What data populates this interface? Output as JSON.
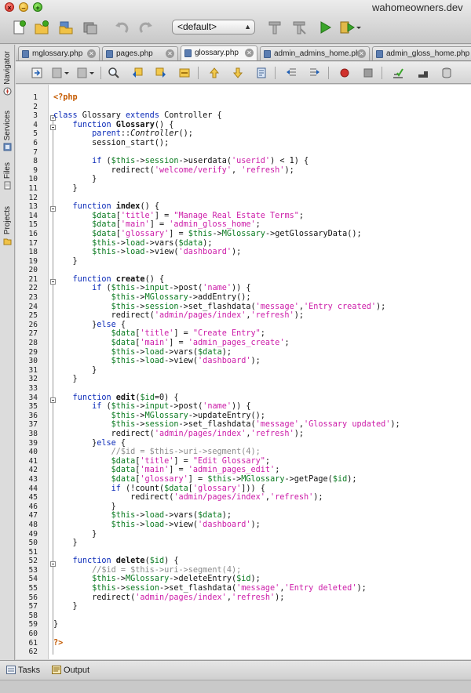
{
  "window": {
    "title": "wahomeowners.dev"
  },
  "toolbar": {
    "config_selected": "<default>"
  },
  "side_tabs": [
    "Navigator",
    "Services",
    "Files",
    "Projects"
  ],
  "tabs": [
    "mglossary.php",
    "pages.php",
    "glossary.php",
    "admin_admins_home.php",
    "admin_gloss_home.php"
  ],
  "active_tab": "glossary.php",
  "bottom": {
    "tasks": "Tasks",
    "output": "Output"
  },
  "code": [
    {
      "n": "1",
      "s": [
        [
          "tag",
          "<?php"
        ]
      ]
    },
    {
      "n": "2",
      "s": []
    },
    {
      "n": "3",
      "s": [
        [
          "kw",
          "class"
        ],
        [
          "p",
          " Glossary "
        ],
        [
          "kw",
          "extends"
        ],
        [
          "p",
          " Controller {"
        ]
      ]
    },
    {
      "n": "4",
      "s": [
        [
          "p",
          "    "
        ],
        [
          "kw",
          "function"
        ],
        [
          "p",
          " "
        ],
        [
          "fn",
          "Glossary"
        ],
        [
          "p",
          "() {"
        ]
      ]
    },
    {
      "n": "5",
      "s": [
        [
          "p",
          "        "
        ],
        [
          "kw",
          "parent"
        ],
        [
          "p",
          "::"
        ],
        [
          "it",
          "Controller"
        ],
        [
          "p",
          "();"
        ]
      ]
    },
    {
      "n": "6",
      "s": [
        [
          "p",
          "        session_start();"
        ]
      ]
    },
    {
      "n": "7",
      "s": []
    },
    {
      "n": "8",
      "s": [
        [
          "p",
          "        "
        ],
        [
          "kw",
          "if"
        ],
        [
          "p",
          " ("
        ],
        [
          "var",
          "$this"
        ],
        [
          "p",
          "->"
        ],
        [
          "var",
          "session"
        ],
        [
          "p",
          "->userdata("
        ],
        [
          "str",
          "'userid'"
        ],
        [
          "p",
          ") < 1) {"
        ]
      ]
    },
    {
      "n": "9",
      "s": [
        [
          "p",
          "            redirect("
        ],
        [
          "str",
          "'welcome/verify'"
        ],
        [
          "p",
          ", "
        ],
        [
          "str",
          "'refresh'"
        ],
        [
          "p",
          ");"
        ]
      ]
    },
    {
      "n": "10",
      "s": [
        [
          "p",
          "        }"
        ]
      ]
    },
    {
      "n": "11",
      "s": [
        [
          "p",
          "    }"
        ]
      ]
    },
    {
      "n": "12",
      "s": []
    },
    {
      "n": "13",
      "s": [
        [
          "p",
          "    "
        ],
        [
          "kw",
          "function"
        ],
        [
          "p",
          " "
        ],
        [
          "fn",
          "index"
        ],
        [
          "p",
          "() {"
        ]
      ]
    },
    {
      "n": "14",
      "s": [
        [
          "p",
          "        "
        ],
        [
          "var",
          "$data"
        ],
        [
          "p",
          "["
        ],
        [
          "str",
          "'title'"
        ],
        [
          "p",
          "] = "
        ],
        [
          "str",
          "\"Manage Real Estate Terms\""
        ],
        [
          "p",
          ";"
        ]
      ]
    },
    {
      "n": "15",
      "s": [
        [
          "p",
          "        "
        ],
        [
          "var",
          "$data"
        ],
        [
          "p",
          "["
        ],
        [
          "str",
          "'main'"
        ],
        [
          "p",
          "] = "
        ],
        [
          "str",
          "'admin_gloss_home'"
        ],
        [
          "p",
          ";"
        ]
      ]
    },
    {
      "n": "16",
      "s": [
        [
          "p",
          "        "
        ],
        [
          "var",
          "$data"
        ],
        [
          "p",
          "["
        ],
        [
          "str",
          "'glossary'"
        ],
        [
          "p",
          "] = "
        ],
        [
          "var",
          "$this"
        ],
        [
          "p",
          "->"
        ],
        [
          "var",
          "MGlossary"
        ],
        [
          "p",
          "->getGlossaryData();"
        ]
      ]
    },
    {
      "n": "17",
      "s": [
        [
          "p",
          "        "
        ],
        [
          "var",
          "$this"
        ],
        [
          "p",
          "->"
        ],
        [
          "var",
          "load"
        ],
        [
          "p",
          "->vars("
        ],
        [
          "var",
          "$data"
        ],
        [
          "p",
          ");"
        ]
      ]
    },
    {
      "n": "18",
      "s": [
        [
          "p",
          "        "
        ],
        [
          "var",
          "$this"
        ],
        [
          "p",
          "->"
        ],
        [
          "var",
          "load"
        ],
        [
          "p",
          "->view("
        ],
        [
          "str",
          "'dashboard'"
        ],
        [
          "p",
          ");"
        ]
      ]
    },
    {
      "n": "19",
      "s": [
        [
          "p",
          "    }"
        ]
      ]
    },
    {
      "n": "20",
      "s": []
    },
    {
      "n": "21",
      "s": [
        [
          "p",
          "    "
        ],
        [
          "kw",
          "function"
        ],
        [
          "p",
          " "
        ],
        [
          "fn",
          "create"
        ],
        [
          "p",
          "() {"
        ]
      ]
    },
    {
      "n": "22",
      "s": [
        [
          "p",
          "        "
        ],
        [
          "kw",
          "if"
        ],
        [
          "p",
          " ("
        ],
        [
          "var",
          "$this"
        ],
        [
          "p",
          "->"
        ],
        [
          "var",
          "input"
        ],
        [
          "p",
          "->post("
        ],
        [
          "str",
          "'name'"
        ],
        [
          "p",
          ")) {"
        ]
      ]
    },
    {
      "n": "23",
      "s": [
        [
          "p",
          "            "
        ],
        [
          "var",
          "$this"
        ],
        [
          "p",
          "->"
        ],
        [
          "var",
          "MGlossary"
        ],
        [
          "p",
          "->addEntry();"
        ]
      ]
    },
    {
      "n": "24",
      "s": [
        [
          "p",
          "            "
        ],
        [
          "var",
          "$this"
        ],
        [
          "p",
          "->"
        ],
        [
          "var",
          "session"
        ],
        [
          "p",
          "->set_flashdata("
        ],
        [
          "str",
          "'message'"
        ],
        [
          "p",
          ","
        ],
        [
          "str",
          "'Entry created'"
        ],
        [
          "p",
          ");"
        ]
      ]
    },
    {
      "n": "25",
      "s": [
        [
          "p",
          "            redirect("
        ],
        [
          "str",
          "'admin/pages/index'"
        ],
        [
          "p",
          ","
        ],
        [
          "str",
          "'refresh'"
        ],
        [
          "p",
          ");"
        ]
      ]
    },
    {
      "n": "26",
      "s": [
        [
          "p",
          "        }"
        ],
        [
          "kw",
          "else"
        ],
        [
          "p",
          " {"
        ]
      ]
    },
    {
      "n": "27",
      "s": [
        [
          "p",
          "            "
        ],
        [
          "var",
          "$data"
        ],
        [
          "p",
          "["
        ],
        [
          "str",
          "'title'"
        ],
        [
          "p",
          "] = "
        ],
        [
          "str",
          "\"Create Entry\""
        ],
        [
          "p",
          ";"
        ]
      ]
    },
    {
      "n": "28",
      "s": [
        [
          "p",
          "            "
        ],
        [
          "var",
          "$data"
        ],
        [
          "p",
          "["
        ],
        [
          "str",
          "'main'"
        ],
        [
          "p",
          "] = "
        ],
        [
          "str",
          "'admin_pages_create'"
        ],
        [
          "p",
          ";"
        ]
      ]
    },
    {
      "n": "29",
      "s": [
        [
          "p",
          "            "
        ],
        [
          "var",
          "$this"
        ],
        [
          "p",
          "->"
        ],
        [
          "var",
          "load"
        ],
        [
          "p",
          "->vars("
        ],
        [
          "var",
          "$data"
        ],
        [
          "p",
          ");"
        ]
      ]
    },
    {
      "n": "30",
      "s": [
        [
          "p",
          "            "
        ],
        [
          "var",
          "$this"
        ],
        [
          "p",
          "->"
        ],
        [
          "var",
          "load"
        ],
        [
          "p",
          "->view("
        ],
        [
          "str",
          "'dashboard'"
        ],
        [
          "p",
          ");"
        ]
      ]
    },
    {
      "n": "31",
      "s": [
        [
          "p",
          "        }"
        ]
      ]
    },
    {
      "n": "32",
      "s": [
        [
          "p",
          "    }"
        ]
      ]
    },
    {
      "n": "33",
      "s": []
    },
    {
      "n": "34",
      "s": [
        [
          "p",
          "    "
        ],
        [
          "kw",
          "function"
        ],
        [
          "p",
          " "
        ],
        [
          "fn",
          "edit"
        ],
        [
          "p",
          "("
        ],
        [
          "var",
          "$id"
        ],
        [
          "p",
          "=0) {"
        ]
      ]
    },
    {
      "n": "35",
      "s": [
        [
          "p",
          "        "
        ],
        [
          "kw",
          "if"
        ],
        [
          "p",
          " ("
        ],
        [
          "var",
          "$this"
        ],
        [
          "p",
          "->"
        ],
        [
          "var",
          "input"
        ],
        [
          "p",
          "->post("
        ],
        [
          "str",
          "'name'"
        ],
        [
          "p",
          ")) {"
        ]
      ]
    },
    {
      "n": "36",
      "s": [
        [
          "p",
          "            "
        ],
        [
          "var",
          "$this"
        ],
        [
          "p",
          "->"
        ],
        [
          "var",
          "MGlossary"
        ],
        [
          "p",
          "->updateEntry();"
        ]
      ]
    },
    {
      "n": "37",
      "s": [
        [
          "p",
          "            "
        ],
        [
          "var",
          "$this"
        ],
        [
          "p",
          "->"
        ],
        [
          "var",
          "session"
        ],
        [
          "p",
          "->set_flashdata("
        ],
        [
          "str",
          "'message'"
        ],
        [
          "p",
          ","
        ],
        [
          "str",
          "'Glossary updated'"
        ],
        [
          "p",
          ");"
        ]
      ]
    },
    {
      "n": "38",
      "s": [
        [
          "p",
          "            redirect("
        ],
        [
          "str",
          "'admin/pages/index'"
        ],
        [
          "p",
          ","
        ],
        [
          "str",
          "'refresh'"
        ],
        [
          "p",
          ");"
        ]
      ]
    },
    {
      "n": "39",
      "s": [
        [
          "p",
          "        }"
        ],
        [
          "kw",
          "else"
        ],
        [
          "p",
          " {"
        ]
      ]
    },
    {
      "n": "40",
      "s": [
        [
          "p",
          "            "
        ],
        [
          "cmt",
          "//$id = $this->uri->segment(4);"
        ]
      ]
    },
    {
      "n": "41",
      "s": [
        [
          "p",
          "            "
        ],
        [
          "var",
          "$data"
        ],
        [
          "p",
          "["
        ],
        [
          "str",
          "'title'"
        ],
        [
          "p",
          "] = "
        ],
        [
          "str",
          "\"Edit Glossary\""
        ],
        [
          "p",
          ";"
        ]
      ]
    },
    {
      "n": "42",
      "s": [
        [
          "p",
          "            "
        ],
        [
          "var",
          "$data"
        ],
        [
          "p",
          "["
        ],
        [
          "str",
          "'main'"
        ],
        [
          "p",
          "] = "
        ],
        [
          "str",
          "'admin_pages_edit'"
        ],
        [
          "p",
          ";"
        ]
      ]
    },
    {
      "n": "43",
      "s": [
        [
          "p",
          "            "
        ],
        [
          "var",
          "$data"
        ],
        [
          "p",
          "["
        ],
        [
          "str",
          "'glossary'"
        ],
        [
          "p",
          "] = "
        ],
        [
          "var",
          "$this"
        ],
        [
          "p",
          "->"
        ],
        [
          "var",
          "MGlossary"
        ],
        [
          "p",
          "->getPage("
        ],
        [
          "var",
          "$id"
        ],
        [
          "p",
          ");"
        ]
      ]
    },
    {
      "n": "44",
      "s": [
        [
          "p",
          "            "
        ],
        [
          "kw",
          "if"
        ],
        [
          "p",
          " (!count("
        ],
        [
          "var",
          "$data"
        ],
        [
          "p",
          "["
        ],
        [
          "str",
          "'glossary'"
        ],
        [
          "p",
          "])) {"
        ]
      ]
    },
    {
      "n": "45",
      "s": [
        [
          "p",
          "                redirect("
        ],
        [
          "str",
          "'admin/pages/index'"
        ],
        [
          "p",
          ","
        ],
        [
          "str",
          "'refresh'"
        ],
        [
          "p",
          ");"
        ]
      ]
    },
    {
      "n": "46",
      "s": [
        [
          "p",
          "            }"
        ]
      ]
    },
    {
      "n": "47",
      "s": [
        [
          "p",
          "            "
        ],
        [
          "var",
          "$this"
        ],
        [
          "p",
          "->"
        ],
        [
          "var",
          "load"
        ],
        [
          "p",
          "->vars("
        ],
        [
          "var",
          "$data"
        ],
        [
          "p",
          ");"
        ]
      ]
    },
    {
      "n": "48",
      "s": [
        [
          "p",
          "            "
        ],
        [
          "var",
          "$this"
        ],
        [
          "p",
          "->"
        ],
        [
          "var",
          "load"
        ],
        [
          "p",
          "->view("
        ],
        [
          "str",
          "'dashboard'"
        ],
        [
          "p",
          ");"
        ]
      ]
    },
    {
      "n": "49",
      "s": [
        [
          "p",
          "        }"
        ]
      ]
    },
    {
      "n": "50",
      "s": [
        [
          "p",
          "    }"
        ]
      ]
    },
    {
      "n": "51",
      "s": []
    },
    {
      "n": "52",
      "s": [
        [
          "p",
          "    "
        ],
        [
          "kw",
          "function"
        ],
        [
          "p",
          " "
        ],
        [
          "fn",
          "delete"
        ],
        [
          "p",
          "("
        ],
        [
          "var",
          "$id"
        ],
        [
          "p",
          ") {"
        ]
      ]
    },
    {
      "n": "53",
      "s": [
        [
          "p",
          "        "
        ],
        [
          "cmt",
          "//$id = $this->uri->segment(4);"
        ]
      ]
    },
    {
      "n": "54",
      "s": [
        [
          "p",
          "        "
        ],
        [
          "var",
          "$this"
        ],
        [
          "p",
          "->"
        ],
        [
          "var",
          "MGlossary"
        ],
        [
          "p",
          "->deleteEntry("
        ],
        [
          "var",
          "$id"
        ],
        [
          "p",
          ");"
        ]
      ]
    },
    {
      "n": "55",
      "s": [
        [
          "p",
          "        "
        ],
        [
          "var",
          "$this"
        ],
        [
          "p",
          "->"
        ],
        [
          "var",
          "session"
        ],
        [
          "p",
          "->set_flashdata("
        ],
        [
          "str",
          "'message'"
        ],
        [
          "p",
          ","
        ],
        [
          "str",
          "'Entry deleted'"
        ],
        [
          "p",
          ");"
        ]
      ]
    },
    {
      "n": "56",
      "s": [
        [
          "p",
          "        redirect("
        ],
        [
          "str",
          "'admin/pages/index'"
        ],
        [
          "p",
          ","
        ],
        [
          "str",
          "'refresh'"
        ],
        [
          "p",
          ");"
        ]
      ]
    },
    {
      "n": "57",
      "s": [
        [
          "p",
          "    }"
        ]
      ]
    },
    {
      "n": "58",
      "s": []
    },
    {
      "n": "59",
      "s": [
        [
          "p",
          "}"
        ]
      ]
    },
    {
      "n": "60",
      "s": []
    },
    {
      "n": "61",
      "s": [
        [
          "tag",
          "?>"
        ]
      ]
    },
    {
      "n": "62",
      "s": []
    }
  ]
}
